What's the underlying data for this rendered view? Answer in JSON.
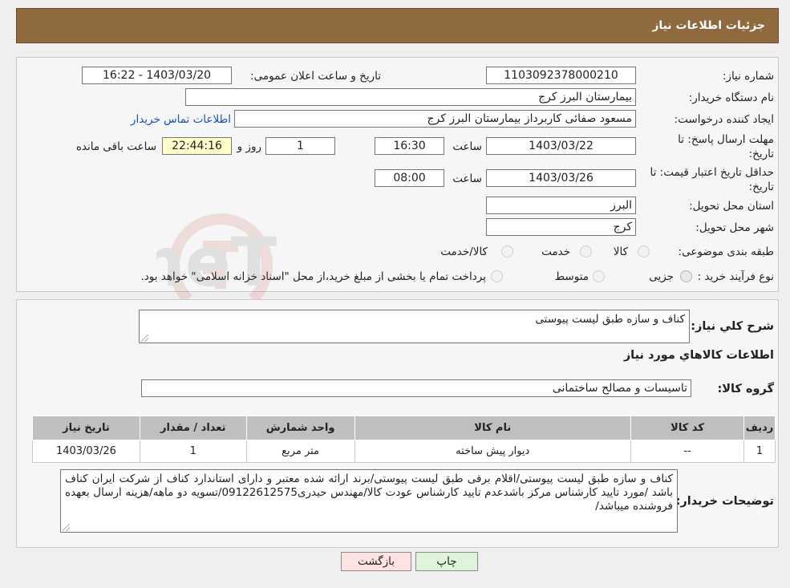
{
  "header": {
    "title": "جزئیات اطلاعات نیاز"
  },
  "form": {
    "need_number": {
      "label": "شماره نیاز:",
      "value": "1103092378000210"
    },
    "announce_datetime": {
      "label": "تاریخ و ساعت اعلان عمومی:",
      "value": "1403/03/20 - 16:22"
    },
    "buyer_org": {
      "label": "نام دستگاه خریدار:",
      "value": "بیمارستان البرز کرج"
    },
    "requester": {
      "label": "ایجاد کننده درخواست:",
      "value": "مسعود صفائی کاربرداز بیمارستان البرز کرج",
      "contact_link": "اطلاعات تماس خریدار"
    },
    "reply_deadline": {
      "label_line1": "مهلت ارسال پاسخ: تا",
      "label_line2": "تاریخ:",
      "date": "1403/03/22",
      "time_label": "ساعت",
      "time": "16:30",
      "days": "1",
      "days_label": "روز و",
      "remaining": "22:44:16",
      "remaining_label": "ساعت باقی مانده"
    },
    "price_validity": {
      "label_line1": "حداقل تاریخ اعتبار قیمت: تا",
      "label_line2": "تاریخ:",
      "date": "1403/03/26",
      "time_label": "ساعت",
      "time": "08:00"
    },
    "delivery_province": {
      "label": "استان محل تحویل:",
      "value": "البرز"
    },
    "delivery_city": {
      "label": "شهر محل تحویل:",
      "value": "کرج"
    },
    "category": {
      "label": "طبقه بندی موضوعی:",
      "options": [
        "کالا",
        "خدمت",
        "کالا/خدمت"
      ]
    },
    "purchase_process": {
      "label": "نوع فرآیند خرید :",
      "options": [
        "جزیی",
        "متوسط"
      ],
      "note": "پرداخت تمام یا بخشی از مبلغ خرید،از محل \"اسناد خزانه اسلامی\" خواهد بود."
    }
  },
  "details": {
    "summary_label": "شرح کلي نياز:",
    "summary_value": "کناف و سازه طبق لیست پیوستی",
    "goods_info_title": "اطلاعات کالاهاي مورد نياز",
    "goods_group_label": "گروه کالا:",
    "goods_group_value": "تاسیسات و مصالح ساختمانی",
    "table": {
      "headers": [
        "رديف",
        "کد کالا",
        "نام کالا",
        "واحد شمارش",
        "تعداد / مقدار",
        "تاريخ نياز"
      ],
      "rows": [
        [
          "1",
          "--",
          "دیوار پیش ساخته",
          "متر مربع",
          "1",
          "1403/03/26"
        ]
      ]
    },
    "buyer_notes_label": "توضيحات خريدار:",
    "buyer_notes_value": "کناف و سازه طبق لیست پیوستی/اقلام برقی طبق لیست پیوستی/برند ارائه شده معتبر و دارای استاندارد کناف از شرکت  ایران کناف باشد /مورد تایید کارشناس مرکز باشدعدم تایید کارشناس عودت کالا/مهندس حیدری09122612575/تسویه دو ماهه/هزینه ارسال بعهده فروشنده میباشد/"
  },
  "buttons": {
    "print": "چاپ",
    "back": "بازگشت"
  },
  "watermark": {
    "text": "AriaTender.neT"
  },
  "colors": {
    "header_bg": "#8e6a3e",
    "back_button_bg": "#ffe3e3",
    "print_button_bg": "#dff5da",
    "link": "#1b4fb8"
  }
}
